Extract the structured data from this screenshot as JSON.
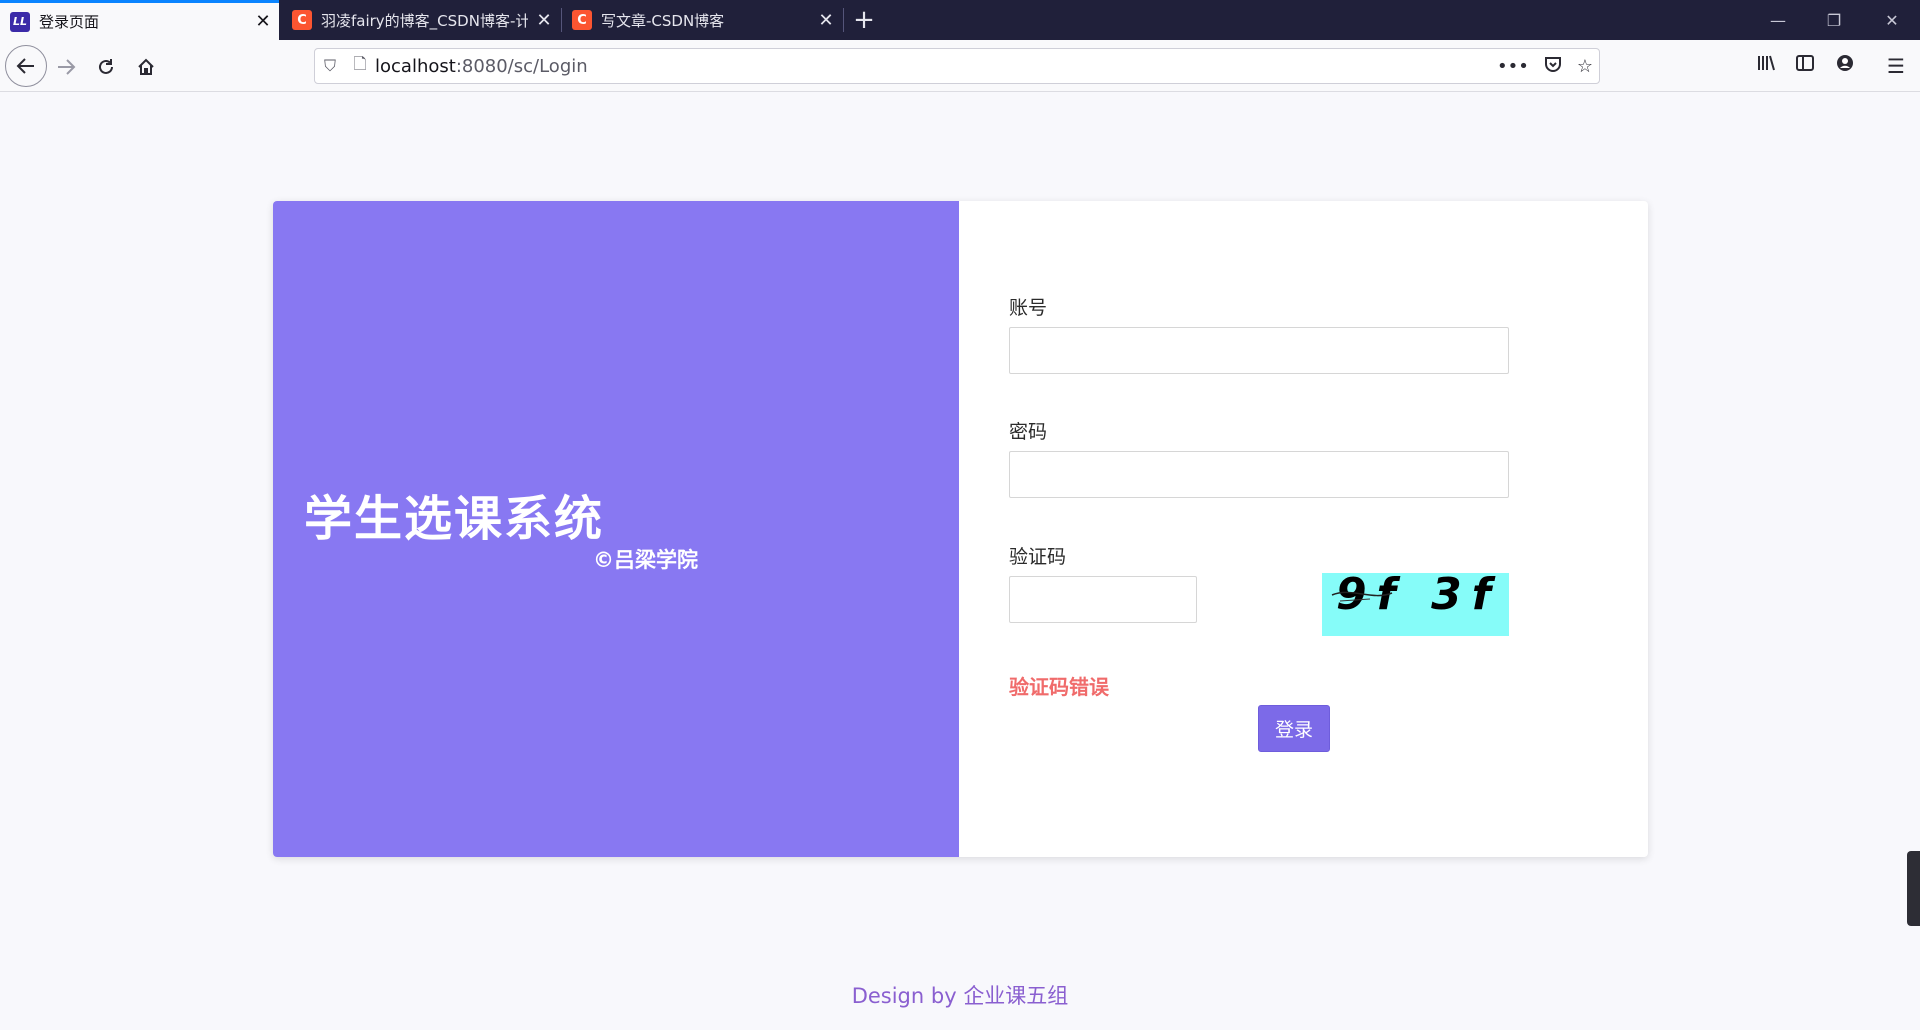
{
  "browser": {
    "tabs": [
      {
        "title": "登录页面",
        "favicon": "LL",
        "active": true
      },
      {
        "title": "羽凌fairy的博客_CSDN博客-计",
        "favicon": "C",
        "active": false
      },
      {
        "title": "写文章-CSDN博客",
        "favicon": "C",
        "active": false
      }
    ],
    "url_host": "localhost",
    "url_path": ":8080/sc/Login",
    "colors": {
      "tabbar": "#20203a",
      "accent": "#0a84ff"
    }
  },
  "hero": {
    "title": "学生选课系统",
    "subtitle": "©吕梁学院",
    "color": "#8878f2"
  },
  "form": {
    "account_label": "账号",
    "account_value": "",
    "password_label": "密码",
    "password_value": "",
    "captcha_label": "验证码",
    "captcha_value": "",
    "captcha_image_text": "9f 3f",
    "error_message": "验证码错误",
    "login_button": "登录",
    "colors": {
      "button": "#7c6ae8",
      "error": "#f06b6b",
      "captcha_bg": "#86fcf9"
    }
  },
  "footer": {
    "prefix": "Design by ",
    "team": "企业课五组"
  }
}
